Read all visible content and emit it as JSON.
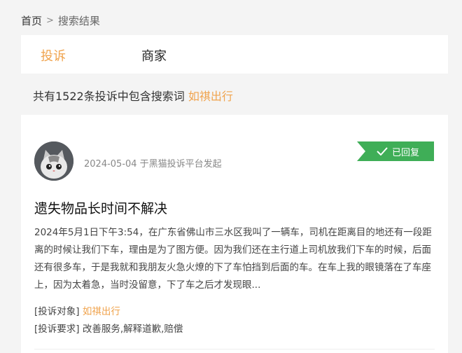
{
  "breadcrumb": {
    "home": "首页",
    "separator": ">",
    "current": "搜索结果"
  },
  "tabs": [
    {
      "label": "投诉",
      "active": true
    },
    {
      "label": "商家",
      "active": false
    }
  ],
  "summary": {
    "prefix": "共有1522条投诉中包含搜索词",
    "keyword": "如祺出行"
  },
  "card": {
    "meta": "2024-05-04 于黑猫投诉平台发起",
    "status": "已回复",
    "title": "遗失物品长时间不解决",
    "content": "2024年5月1日下午3:54，在广东省佛山市三水区我叫了一辆车，司机在距离目的地还有一段距离的时候让我们下车，理由是为了图方便。因为我们还在主行道上司机放我们下车的时候，后面还有很多车，于是我就和我朋友火急火燎的下了车怕挡到后面的车。在车上我的眼镜落在了车座上，因为太着急，当时没留意，下了车之后才发现眼...",
    "target_label": "[投诉对象]",
    "target_value": "如祺出行",
    "request_label": "[投诉要求]",
    "request_value": "改善服务,解释道歉,赔偿"
  },
  "colors": {
    "accent": "#f0a34d",
    "badge": "#3fae57"
  }
}
